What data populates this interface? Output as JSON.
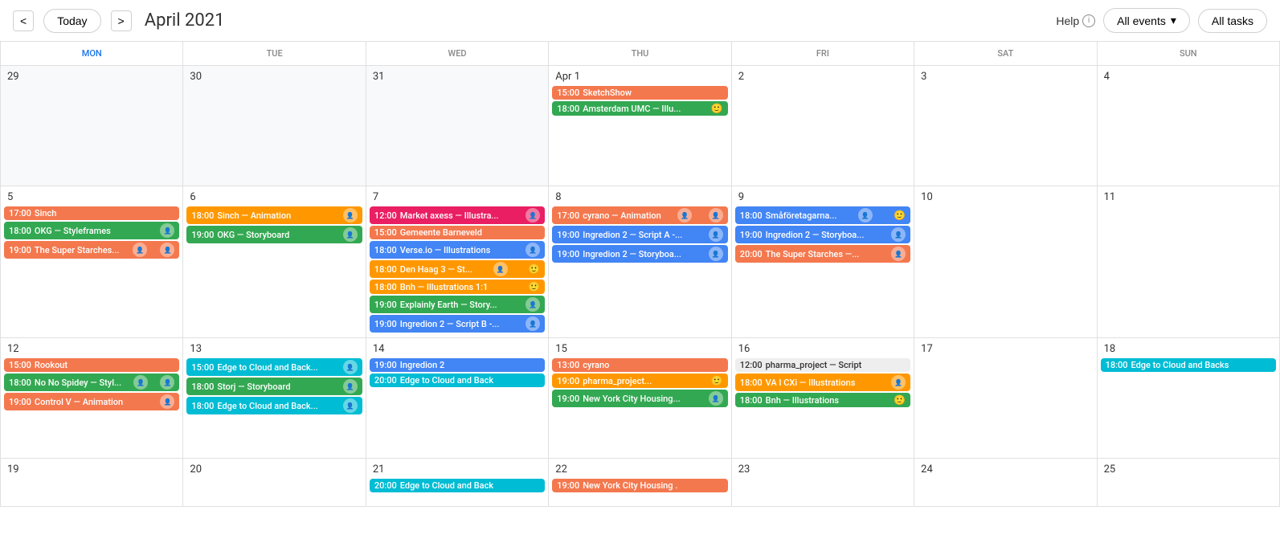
{
  "header": {
    "prev_label": "<",
    "next_label": ">",
    "today_label": "Today",
    "title": "April 2021",
    "help_label": "Help",
    "events_dropdown_label": "All events",
    "tasks_label": "All tasks"
  },
  "day_headers": [
    {
      "label": "MON",
      "style": "blue"
    },
    {
      "label": "TUE",
      "style": "normal"
    },
    {
      "label": "WED",
      "style": "normal"
    },
    {
      "label": "THU",
      "style": "normal"
    },
    {
      "label": "FRI",
      "style": "normal"
    },
    {
      "label": "SAT",
      "style": "normal"
    },
    {
      "label": "SUN",
      "style": "normal"
    }
  ],
  "weeks": [
    {
      "days": [
        {
          "num": "29",
          "other": true,
          "events": []
        },
        {
          "num": "30",
          "other": true,
          "events": []
        },
        {
          "num": "31",
          "other": true,
          "events": []
        },
        {
          "num": "Apr 1",
          "events": [
            {
              "time": "15:00",
              "title": "SketchShow",
              "color": "event-orange"
            },
            {
              "time": "18:00",
              "title": "Amsterdam UMC — Illu...",
              "color": "event-green",
              "has_smiley": true
            }
          ]
        },
        {
          "num": "2",
          "events": []
        },
        {
          "num": "3",
          "events": []
        },
        {
          "num": "4",
          "events": []
        }
      ]
    },
    {
      "days": [
        {
          "num": "5",
          "events": [
            {
              "time": "17:00",
              "title": "Sinch",
              "color": "event-orange"
            },
            {
              "time": "18:00",
              "title": "OKG — Styleframes",
              "color": "event-green",
              "has_avatar": true
            },
            {
              "time": "19:00",
              "title": "The Super Starches...",
              "color": "event-orange",
              "has_avatars": true
            }
          ]
        },
        {
          "num": "6",
          "events": [
            {
              "time": "18:00",
              "title": "Sinch — Animation",
              "color": "event-amber",
              "has_avatar": true
            },
            {
              "time": "19:00",
              "title": "OKG — Storyboard",
              "color": "event-green",
              "has_avatar": true
            }
          ]
        },
        {
          "num": "7",
          "events": [
            {
              "time": "12:00",
              "title": "Market axess — Illustra...",
              "color": "event-pink",
              "has_avatar": true
            },
            {
              "time": "15:00",
              "title": "Gemeente Barneveld",
              "color": "event-orange"
            },
            {
              "time": "18:00",
              "title": "Verse.io — Illustrations",
              "color": "event-blue",
              "has_avatar": true
            },
            {
              "time": "18:00",
              "title": "Den Haag 3 — St...",
              "color": "event-amber",
              "has_avatars": true
            },
            {
              "time": "18:00",
              "title": "Bnh — Illustrations 1:1",
              "color": "event-amber",
              "has_smiley": true
            },
            {
              "time": "19:00",
              "title": "Explainly Earth — Story...",
              "color": "event-green",
              "has_avatar": true
            },
            {
              "time": "19:00",
              "title": "Ingredion 2 — Script B -...",
              "color": "event-blue",
              "has_avatar": true
            }
          ]
        },
        {
          "num": "8",
          "events": [
            {
              "time": "17:00",
              "title": "cyrano — Animation",
              "color": "event-orange",
              "has_avatars": true
            },
            {
              "time": "19:00",
              "title": "Ingredion 2 — Script A -...",
              "color": "event-blue",
              "has_avatar": true
            },
            {
              "time": "19:00",
              "title": "Ingredion 2 — Storyboa...",
              "color": "event-blue",
              "has_avatar": true
            }
          ]
        },
        {
          "num": "9",
          "events": [
            {
              "time": "18:00",
              "title": "Småföretagarna...",
              "color": "event-blue",
              "has_avatars": true
            },
            {
              "time": "19:00",
              "title": "Ingredion 2 — Storyboa...",
              "color": "event-blue",
              "has_avatar": true
            },
            {
              "time": "20:00",
              "title": "The Super Starches —...",
              "color": "event-orange",
              "has_avatar": true
            }
          ]
        },
        {
          "num": "10",
          "events": []
        },
        {
          "num": "11",
          "events": []
        }
      ]
    },
    {
      "days": [
        {
          "num": "12",
          "events": [
            {
              "time": "15:00",
              "title": "Rookout",
              "color": "event-orange"
            },
            {
              "time": "18:00",
              "title": "No No Spidey — Styl...",
              "color": "event-green",
              "has_avatars": true
            },
            {
              "time": "19:00",
              "title": "Control V — Animation",
              "color": "event-orange",
              "has_avatar": true
            }
          ]
        },
        {
          "num": "13",
          "events": [
            {
              "time": "15:00",
              "title": "Edge to Cloud and Back...",
              "color": "event-teal",
              "has_avatar": true
            },
            {
              "time": "18:00",
              "title": "Storj — Storyboard",
              "color": "event-green",
              "has_avatar": true
            },
            {
              "time": "18:00",
              "title": "Edge to Cloud and Back...",
              "color": "event-teal",
              "has_avatar": true
            }
          ]
        },
        {
          "num": "14",
          "events": [
            {
              "time": "19:00",
              "title": "Ingredion 2",
              "color": "event-blue"
            },
            {
              "time": "20:00",
              "title": "Edge to Cloud and Back",
              "color": "event-teal"
            }
          ]
        },
        {
          "num": "15",
          "events": [
            {
              "time": "13:00",
              "title": "cyrano",
              "color": "event-orange"
            },
            {
              "time": "19:00",
              "title": "pharma_project...",
              "color": "event-amber",
              "has_smiley": true
            },
            {
              "time": "19:00",
              "title": "New York City Housing...",
              "color": "event-green",
              "has_avatar": true
            }
          ]
        },
        {
          "num": "16",
          "events": [
            {
              "time": "12:00",
              "title": "pharma_project — Script",
              "color": "event-light-gray"
            },
            {
              "time": "18:00",
              "title": "VA I CXi — Illustrations",
              "color": "event-amber",
              "has_avatar": true
            },
            {
              "time": "18:00",
              "title": "Bnh — Illustrations",
              "color": "event-green",
              "has_smiley": true
            }
          ]
        },
        {
          "num": "17",
          "events": []
        },
        {
          "num": "18",
          "events": []
        }
      ]
    }
  ]
}
